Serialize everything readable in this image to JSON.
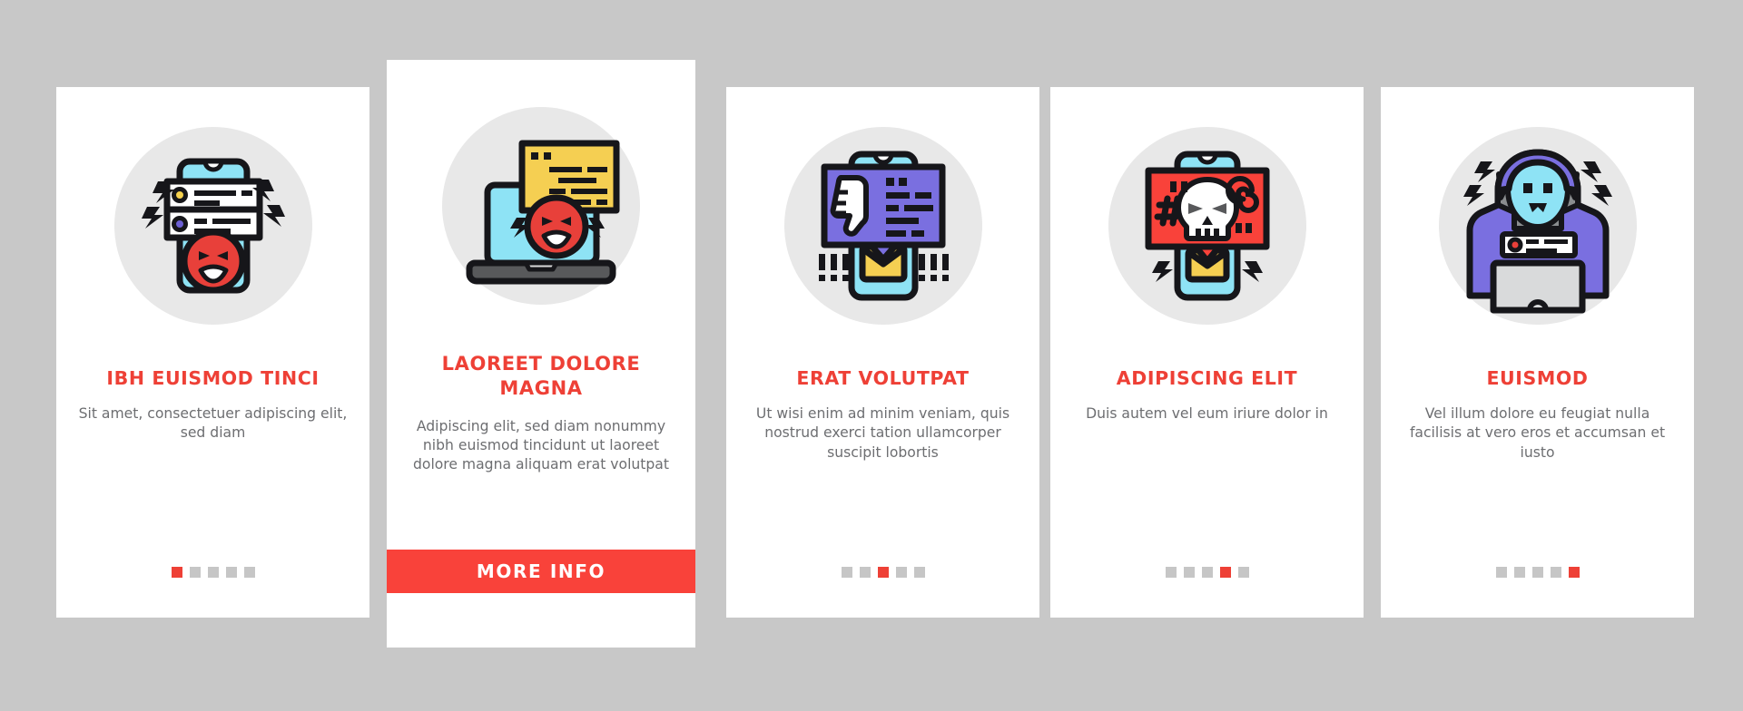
{
  "page": {
    "background_color": "#c8c8c8",
    "card_background": "#ffffff",
    "accent_color": "#ee4036",
    "button_color": "#f9423a",
    "body_text_color": "#6d6e71",
    "dot_color": "#c6c6c6",
    "illustration_disc_color": "#e8e8e8"
  },
  "cards": [
    {
      "icon_name": "angry-face-phone-alert-icon",
      "title": "IBH EUISMOD TINCI",
      "body": "Sit amet, consectetuer adipiscing elit, sed diam",
      "dots_total": 5,
      "dots_active_index": 0,
      "featured": false
    },
    {
      "icon_name": "angry-face-laptop-popup-icon",
      "title": "LAOREET DOLORE MAGNA",
      "body": "Adipiscing elit, sed diam nonummy nibh euismod tincidunt ut laoreet dolore magna aliquam erat volutpat",
      "dots_total": 5,
      "dots_active_index": 1,
      "featured": true,
      "button_label": "MORE INFO"
    },
    {
      "icon_name": "thumbs-down-message-phone-icon",
      "title": "ERAT VOLUTPAT",
      "body": "Ut wisi enim ad minim veniam, quis nostrud exerci tation ullamcorper suscipit lobortis",
      "dots_total": 5,
      "dots_active_index": 2,
      "featured": false
    },
    {
      "icon_name": "skull-threat-message-phone-icon",
      "title": "ADIPISCING ELIT",
      "body": "Duis autem vel eum iriure dolor in",
      "dots_total": 5,
      "dots_active_index": 3,
      "featured": false
    },
    {
      "icon_name": "hooded-hacker-laptop-icon",
      "title": "EUISMOD",
      "body": "Vel illum dolore eu feugiat nulla facilisis at vero eros et accumsan et iusto",
      "dots_total": 5,
      "dots_active_index": 4,
      "featured": false
    }
  ]
}
